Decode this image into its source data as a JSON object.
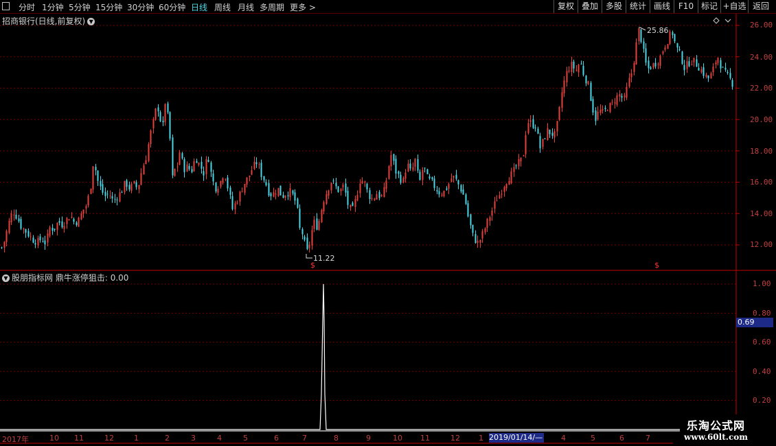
{
  "toolbar": {
    "periods": [
      "分时",
      "1分钟",
      "5分钟",
      "15分钟",
      "30分钟",
      "60分钟",
      "日线",
      "周线",
      "月线",
      "多周期",
      "更多 >"
    ],
    "active_period": "日线",
    "right_buttons": [
      "复权",
      "叠加",
      "多股",
      "统计",
      "画线",
      "F10",
      "标记",
      "+自选",
      "返回"
    ]
  },
  "main_chart": {
    "title": "招商银行(日线,前复权)",
    "high_label": "25.86",
    "low_label": "11.22",
    "signal_marker": "$"
  },
  "indicator": {
    "title": "股朋指标网",
    "formula_label": "鼎牛涨停狙击: 0.00",
    "current_value": "0.69"
  },
  "date_axis": {
    "labels": [
      "2017年",
      "10",
      "11",
      "12",
      "1",
      "2",
      "3",
      "4",
      "5",
      "6",
      "7",
      "8",
      "9",
      "10",
      "11",
      "12",
      "1",
      "4",
      "5",
      "6",
      "7"
    ],
    "highlight": "2019/01/14/—"
  },
  "watermark": {
    "text": "乐淘公式网",
    "url": "www.60lt.com"
  },
  "colors": {
    "up": "#e8403c",
    "down": "#48d8e8",
    "grid": "#7a0000",
    "axis": "#c00000"
  },
  "chart_data": {
    "type": "candlestick",
    "title": "招商银行(日线,前复权)",
    "y_axis_ticks": [
      "26.00",
      "24.00",
      "22.00",
      "20.00",
      "18.00",
      "16.00",
      "14.00",
      "12.00"
    ],
    "ylim": [
      10.5,
      26.2
    ],
    "high": 25.86,
    "low": 11.22,
    "close_path": [
      [
        0,
        11.6
      ],
      [
        6,
        12.3
      ],
      [
        12,
        13.4
      ],
      [
        18,
        14.2
      ],
      [
        24,
        13.8
      ],
      [
        30,
        13.2
      ],
      [
        36,
        12.9
      ],
      [
        42,
        12.6
      ],
      [
        48,
        12.3
      ],
      [
        54,
        12.2
      ],
      [
        60,
        12.4
      ],
      [
        66,
        12.1
      ],
      [
        72,
        13.1
      ],
      [
        78,
        13.0
      ],
      [
        84,
        13.5
      ],
      [
        90,
        13.3
      ],
      [
        96,
        13.6
      ],
      [
        102,
        13.9
      ],
      [
        108,
        13.4
      ],
      [
        114,
        13.6
      ],
      [
        120,
        14.2
      ],
      [
        126,
        14.6
      ],
      [
        132,
        15.9
      ],
      [
        136,
        17.6
      ],
      [
        140,
        16.3
      ],
      [
        146,
        15.6
      ],
      [
        152,
        15.1
      ],
      [
        158,
        15.3
      ],
      [
        164,
        14.8
      ],
      [
        170,
        15.1
      ],
      [
        176,
        15.4
      ],
      [
        182,
        16.0
      ],
      [
        188,
        15.6
      ],
      [
        194,
        15.9
      ],
      [
        200,
        15.6
      ],
      [
        206,
        16.8
      ],
      [
        212,
        17.6
      ],
      [
        218,
        19.0
      ],
      [
        224,
        20.1
      ],
      [
        228,
        21.0
      ],
      [
        232,
        20.2
      ],
      [
        236,
        19.4
      ],
      [
        240,
        21.1
      ],
      [
        246,
        19.6
      ],
      [
        250,
        16.2
      ],
      [
        254,
        16.8
      ],
      [
        258,
        17.1
      ],
      [
        262,
        18.2
      ],
      [
        266,
        16.8
      ],
      [
        272,
        17.0
      ],
      [
        278,
        16.7
      ],
      [
        284,
        17.6
      ],
      [
        290,
        17.1
      ],
      [
        296,
        16.6
      ],
      [
        302,
        17.8
      ],
      [
        308,
        16.2
      ],
      [
        314,
        15.6
      ],
      [
        320,
        16.0
      ],
      [
        326,
        16.7
      ],
      [
        332,
        15.5
      ],
      [
        338,
        14.3
      ],
      [
        344,
        14.8
      ],
      [
        350,
        15.4
      ],
      [
        356,
        16.0
      ],
      [
        362,
        16.4
      ],
      [
        368,
        17.0
      ],
      [
        374,
        17.3
      ],
      [
        380,
        16.5
      ],
      [
        386,
        16.0
      ],
      [
        392,
        15.2
      ],
      [
        398,
        15.3
      ],
      [
        404,
        15.6
      ],
      [
        410,
        15.1
      ],
      [
        416,
        15.3
      ],
      [
        422,
        15.4
      ],
      [
        428,
        15.0
      ],
      [
        432,
        14.3
      ],
      [
        436,
        13.0
      ],
      [
        440,
        12.7
      ],
      [
        446,
        11.5
      ],
      [
        450,
        12.1
      ],
      [
        456,
        13.5
      ],
      [
        462,
        13.1
      ],
      [
        466,
        14.0
      ],
      [
        470,
        14.8
      ],
      [
        476,
        15.5
      ],
      [
        482,
        16.1
      ],
      [
        488,
        15.7
      ],
      [
        494,
        15.4
      ],
      [
        500,
        15.8
      ],
      [
        506,
        14.6
      ],
      [
        512,
        14.1
      ],
      [
        518,
        15.0
      ],
      [
        524,
        16.2
      ],
      [
        530,
        16.0
      ],
      [
        536,
        15.2
      ],
      [
        542,
        14.9
      ],
      [
        548,
        15.3
      ],
      [
        554,
        15.0
      ],
      [
        560,
        15.6
      ],
      [
        566,
        17.2
      ],
      [
        570,
        17.9
      ],
      [
        574,
        16.8
      ],
      [
        580,
        16.4
      ],
      [
        586,
        16.0
      ],
      [
        592,
        17.2
      ],
      [
        598,
        16.6
      ],
      [
        604,
        17.4
      ],
      [
        610,
        15.9
      ],
      [
        616,
        17.1
      ],
      [
        622,
        16.2
      ],
      [
        628,
        16.0
      ],
      [
        634,
        15.6
      ],
      [
        640,
        15.3
      ],
      [
        646,
        15.4
      ],
      [
        652,
        15.8
      ],
      [
        658,
        16.4
      ],
      [
        664,
        16.1
      ],
      [
        670,
        15.6
      ],
      [
        676,
        15.0
      ],
      [
        682,
        13.6
      ],
      [
        688,
        12.6
      ],
      [
        694,
        12.1
      ],
      [
        698,
        12.3
      ],
      [
        704,
        12.9
      ],
      [
        710,
        13.6
      ],
      [
        716,
        14.2
      ],
      [
        722,
        14.9
      ],
      [
        728,
        15.3
      ],
      [
        734,
        15.9
      ],
      [
        740,
        16.3
      ],
      [
        746,
        16.6
      ],
      [
        752,
        17.1
      ],
      [
        758,
        17.4
      ],
      [
        762,
        17.9
      ],
      [
        766,
        19.6
      ],
      [
        770,
        20.0
      ],
      [
        774,
        19.6
      ],
      [
        778,
        19.8
      ],
      [
        782,
        19.0
      ],
      [
        786,
        18.2
      ],
      [
        790,
        18.6
      ],
      [
        796,
        19.3
      ],
      [
        802,
        19.1
      ],
      [
        808,
        19.0
      ],
      [
        814,
        20.6
      ],
      [
        818,
        21.9
      ],
      [
        822,
        22.6
      ],
      [
        826,
        23.2
      ],
      [
        832,
        23.5
      ],
      [
        838,
        23.1
      ],
      [
        844,
        23.7
      ],
      [
        850,
        22.8
      ],
      [
        856,
        22.2
      ],
      [
        862,
        20.8
      ],
      [
        866,
        20.0
      ],
      [
        872,
        20.6
      ],
      [
        878,
        20.4
      ],
      [
        884,
        20.8
      ],
      [
        890,
        20.9
      ],
      [
        896,
        21.4
      ],
      [
        902,
        21.6
      ],
      [
        908,
        21.2
      ],
      [
        914,
        22.3
      ],
      [
        920,
        23.1
      ],
      [
        926,
        24.8
      ],
      [
        930,
        25.8
      ],
      [
        934,
        24.9
      ],
      [
        938,
        23.9
      ],
      [
        942,
        23.2
      ],
      [
        948,
        23.4
      ],
      [
        954,
        23.6
      ],
      [
        960,
        23.9
      ],
      [
        966,
        24.6
      ],
      [
        972,
        25.1
      ],
      [
        978,
        25.6
      ],
      [
        984,
        24.6
      ],
      [
        990,
        24.1
      ],
      [
        996,
        23.3
      ],
      [
        1002,
        23.6
      ],
      [
        1008,
        23.8
      ],
      [
        1014,
        23.5
      ],
      [
        1020,
        23.2
      ],
      [
        1026,
        22.8
      ],
      [
        1032,
        22.6
      ],
      [
        1038,
        23.2
      ],
      [
        1044,
        24.1
      ],
      [
        1050,
        23.3
      ],
      [
        1056,
        22.9
      ],
      [
        1062,
        22.6
      ],
      [
        1066,
        22.3
      ],
      [
        1070,
        23.5
      ]
    ]
  }
}
